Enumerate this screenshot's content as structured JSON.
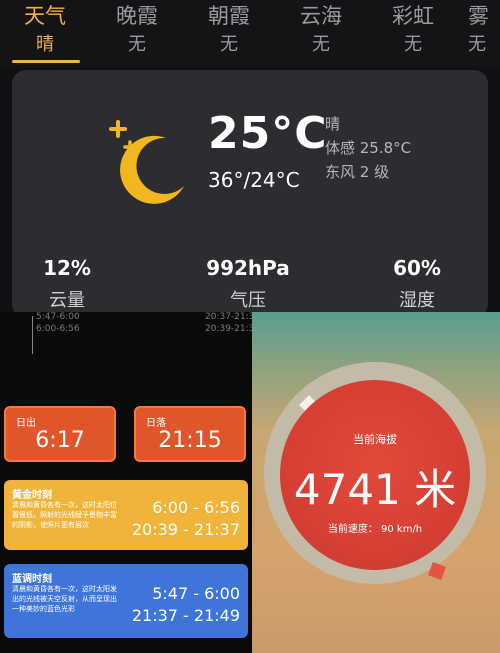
{
  "tabs": [
    {
      "title": "天气",
      "value": "晴",
      "active": true
    },
    {
      "title": "晚霞",
      "value": "无"
    },
    {
      "title": "朝霞",
      "value": "无"
    },
    {
      "title": "云海",
      "value": "无"
    },
    {
      "title": "彩虹",
      "value": "无"
    },
    {
      "title": "雾",
      "value": "无"
    }
  ],
  "weather": {
    "icon": "moon-stars-icon",
    "temp": "25°C",
    "range": "36°/24°C",
    "condition": "晴",
    "feels": "体感 25.8°C",
    "wind": "东风 2 级",
    "stats": [
      {
        "value": "12%",
        "label": "云量"
      },
      {
        "value": "992hPa",
        "label": "气压"
      },
      {
        "value": "60%",
        "label": "湿度"
      }
    ]
  },
  "ghost": {
    "a1": "5:47-6:00",
    "a2": "6:00-6:56",
    "b1": "20:37-21:37",
    "b2": "20:39-21:37"
  },
  "sunrise": {
    "label": "日出",
    "value": "6:17"
  },
  "sunset": {
    "label": "日落",
    "value": "21:15"
  },
  "golden_hour": {
    "title": "黄金时刻",
    "desc": "清晨和黄昏各有一次，这时太阳位置很低，照射的光线赋予景物丰富的阴影，使照片更有层次",
    "morning": "6:00 - 6:56",
    "evening": "20:39 - 21:37"
  },
  "blue_hour": {
    "title": "蓝调时刻",
    "desc": "清晨和黄昏各有一次，这时太阳发出的光线被天空反射，从而呈现出一种美妙的蓝色光彩",
    "morning": "5:47 - 6:00",
    "evening": "21:37 - 21:49"
  },
  "altitude": {
    "title": "当前海拔",
    "value": "4741 米",
    "speed": "当前速度： 90 km/h"
  },
  "colors": {
    "accent": "#f1b04a",
    "orange": "#e0562a",
    "gold": "#f0b43a",
    "blue": "#3f74d8",
    "gauge_red": "#d63f34"
  }
}
